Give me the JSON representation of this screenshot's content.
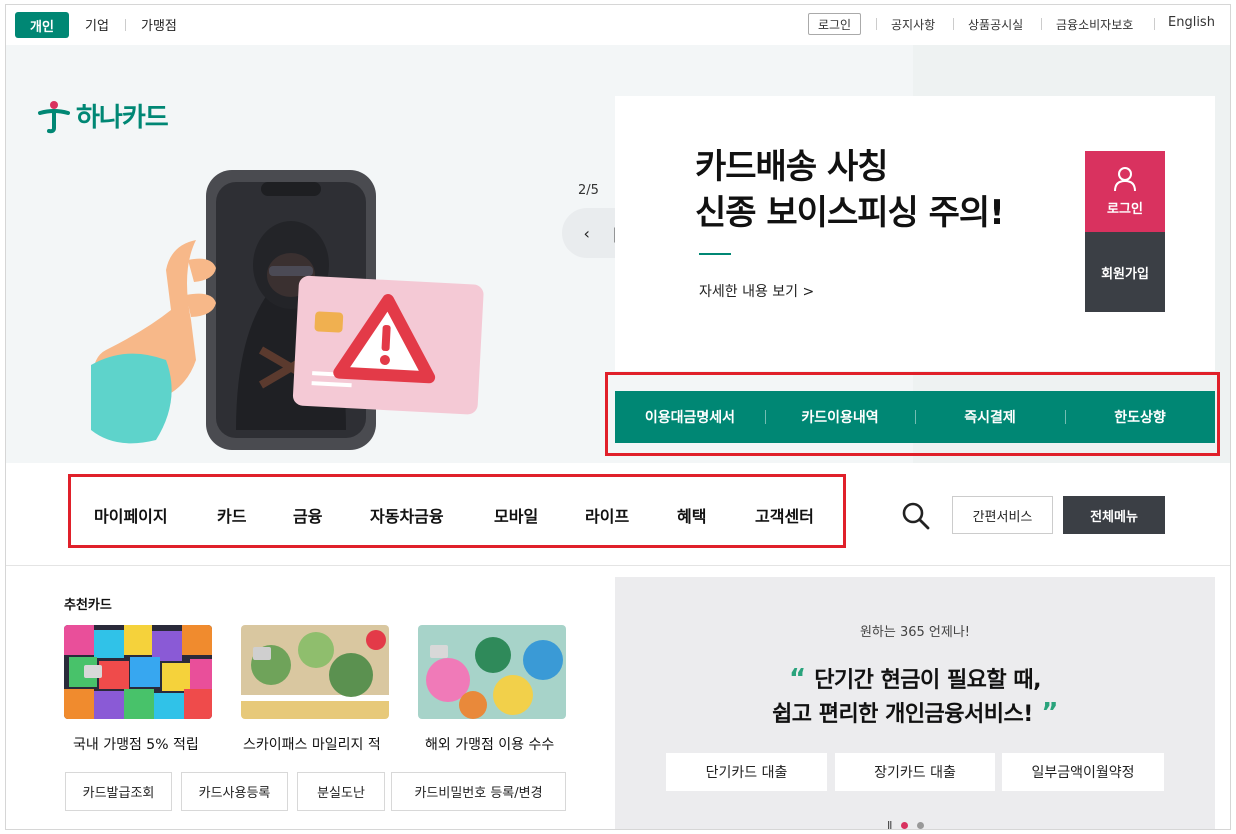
{
  "topbar": {
    "segments": [
      "개인",
      "기업",
      "가맹점"
    ],
    "login": "로그인",
    "links": [
      "공지사항",
      "상품공시실",
      "금융소비자보호"
    ],
    "english": "English"
  },
  "brand": {
    "name": "하나카드",
    "color": "#008774"
  },
  "hero": {
    "slide_counter": "2/5",
    "title_line1": "카드배송 사칭",
    "title_line2": "신종 보이스피싱 주의!",
    "more_link": "자세한 내용 보기 >",
    "login_label": "로그인",
    "join_label": "회원가입"
  },
  "quick_menu": [
    "이용대금명세서",
    "카드이용내역",
    "즉시결제",
    "한도상향"
  ],
  "nav": {
    "items": [
      "마이페이지",
      "카드",
      "금융",
      "자동차금융",
      "모바일",
      "라이프",
      "혜택",
      "고객센터"
    ],
    "easy_service": "간편서비스",
    "all_menu": "전체메뉴"
  },
  "recommended": {
    "title": "추천카드",
    "cards": [
      "국내 가맹점 5% 적립",
      "스카이패스 마일리지 적",
      "해외 가맹점 이용 수수"
    ],
    "shortcuts": [
      "카드발급조회",
      "카드사용등록",
      "분실도난",
      "카드비밀번호 등록/변경"
    ]
  },
  "finance_promo": {
    "subtitle": "원하는 365 언제나!",
    "quote_line1": "단기간 현금이 필요할 때,",
    "quote_line2": "쉽고 편리한 개인금융서비스!",
    "buttons": [
      "단기카드 대출",
      "장기카드 대출",
      "일부금액이월약정"
    ]
  },
  "colors": {
    "accent": "#008774",
    "login_pink": "#d9325f",
    "dark": "#3b3f45",
    "highlight_red": "#e0202a"
  }
}
